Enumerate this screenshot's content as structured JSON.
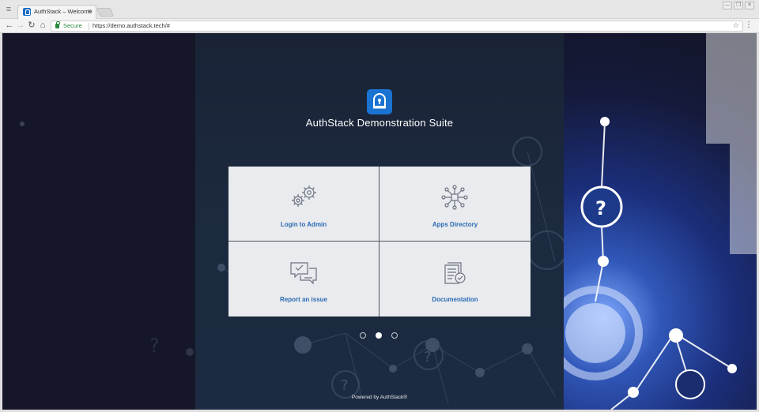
{
  "browser": {
    "tab_title": "AuthStack – Welcome",
    "tab_close": "×",
    "secure_label": "Secure",
    "url": "https://demo.authstack.tech/#",
    "win_minimize": "—",
    "win_restore": "❐",
    "win_close": "✕"
  },
  "page": {
    "title": "AuthStack Demonstration Suite",
    "footer": "Powered by AuthStack®",
    "active_slide": 2,
    "slide_count": 3
  },
  "tiles": [
    {
      "label": "Login to Admin",
      "icon": "gears-icon"
    },
    {
      "label": "Apps Directory",
      "icon": "network-hub-icon"
    },
    {
      "label": "Report an issue",
      "icon": "chat-bubbles-icon"
    },
    {
      "label": "Documentation",
      "icon": "document-check-icon"
    }
  ],
  "colors": {
    "brand_blue": "#1a73d1",
    "tile_label": "#2a69b3",
    "secure_green": "#2b8a3e"
  }
}
